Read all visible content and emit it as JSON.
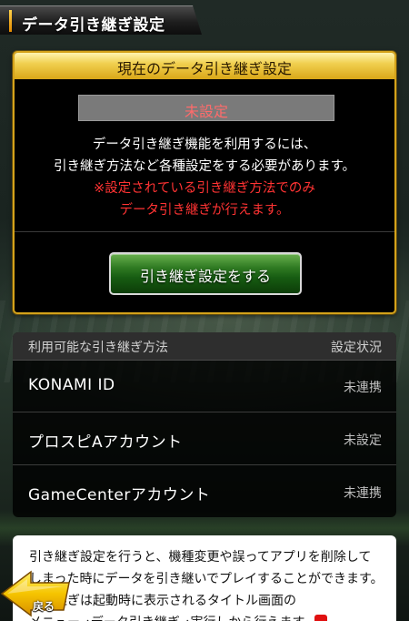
{
  "header": {
    "title": "データ引き継ぎ設定"
  },
  "status_panel": {
    "title": "現在のデータ引き継ぎ設定",
    "status_value": "未設定",
    "description_line1": "データ引き継ぎ機能を利用するには、",
    "description_line2": "引き継ぎ方法など各種設定をする必要があります。",
    "warning_line1": "※設定されている引き継ぎ方法でのみ",
    "warning_line2": "データ引き継ぎが行えます。",
    "setup_button_label": "引き継ぎ設定をする"
  },
  "methods": {
    "header_left": "利用可能な引き継ぎ方法",
    "header_right": "設定状況",
    "rows": [
      {
        "name": "KONAMI  ID",
        "status": "未連携"
      },
      {
        "name": "プロスピAアカウント",
        "status": "未設定"
      },
      {
        "name": "GameCenterアカウント",
        "status": "未連携"
      }
    ]
  },
  "info": {
    "line1": "引き継ぎ設定を行うと、機種変更や誤ってアプリを削除して",
    "line2": "しまった時にデータを引き継いでプレイすることができます。",
    "line3": "引き継ぎは起動時に表示されるタイトル画面の",
    "line4": "メニュー→データ引き継ぎ→実行しから行えます。"
  },
  "back_button": {
    "label": "戻る"
  },
  "colors": {
    "accent_gold": "#d4a21a",
    "warning_red": "#ff3333",
    "button_green": "#2f7a22",
    "back_yellow": "#f5c400"
  }
}
